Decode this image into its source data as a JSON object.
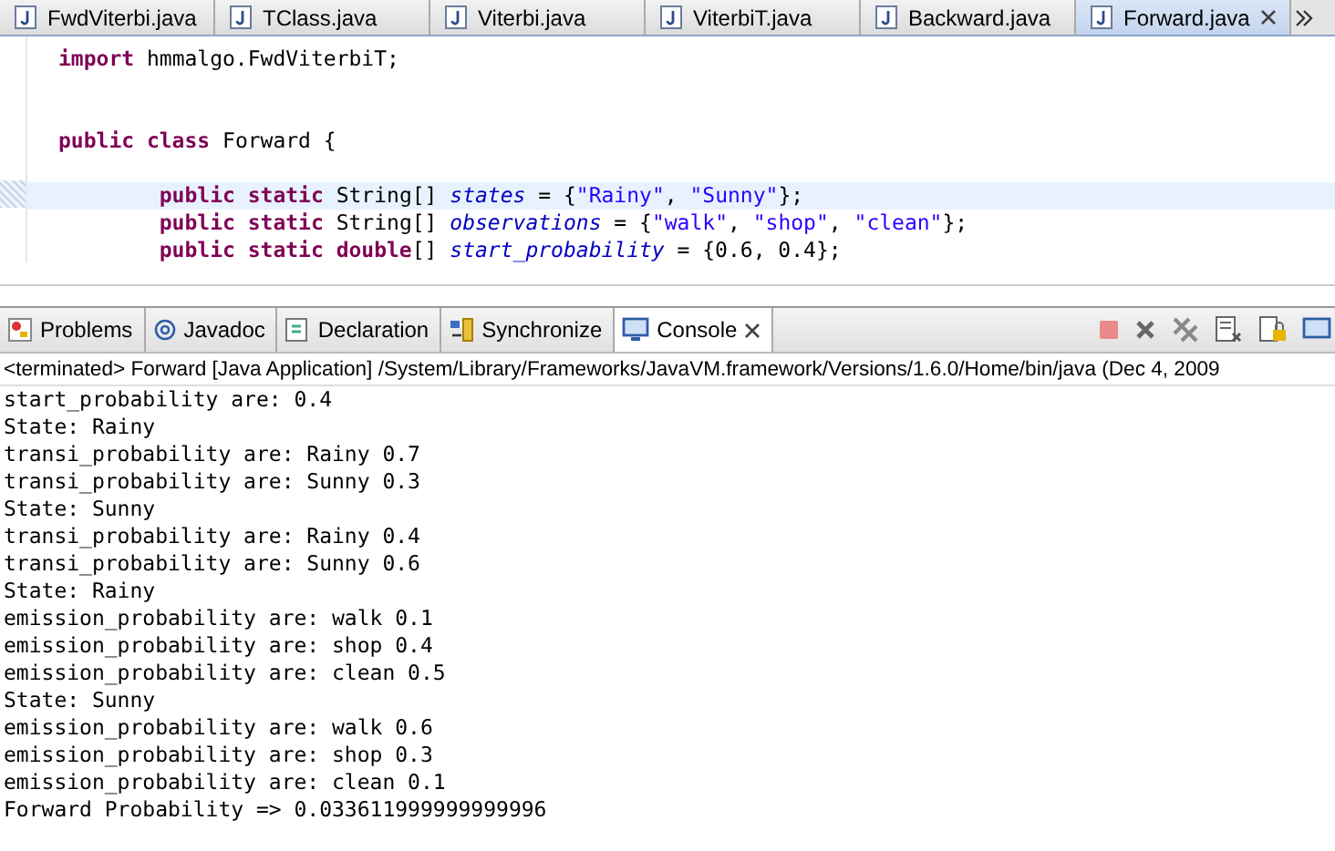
{
  "editor_tabs": [
    {
      "label": "FwdViterbi.java",
      "selected": false
    },
    {
      "label": "TClass.java",
      "selected": false
    },
    {
      "label": "Viterbi.java",
      "selected": false
    },
    {
      "label": "ViterbiT.java",
      "selected": false
    },
    {
      "label": "Backward.java",
      "selected": false
    },
    {
      "label": "Forward.java",
      "selected": true
    }
  ],
  "editor": {
    "lines": [
      {
        "highlighted": false,
        "tokens": [
          {
            "kind": "keyword",
            "text": "import"
          },
          {
            "kind": "plain",
            "text": " hmmalgo.FwdViterbiT;"
          }
        ]
      },
      {
        "highlighted": false
      },
      {
        "highlighted": false
      },
      {
        "highlighted": false,
        "tokens": [
          {
            "kind": "keyword",
            "text": "public class"
          },
          {
            "kind": "plain",
            "text": " Forward {"
          }
        ]
      },
      {
        "highlighted": false
      },
      {
        "highlighted": true,
        "tokens": [
          {
            "kind": "keyword",
            "text": "        public static"
          },
          {
            "kind": "plain",
            "text": " String[] "
          },
          {
            "kind": "field",
            "text": "states"
          },
          {
            "kind": "plain",
            "text": " = {"
          },
          {
            "kind": "string",
            "text": "\"Rainy\""
          },
          {
            "kind": "plain",
            "text": ", "
          },
          {
            "kind": "string",
            "text": "\"Sunny\""
          },
          {
            "kind": "plain",
            "text": "};"
          }
        ]
      },
      {
        "highlighted": false,
        "tokens": [
          {
            "kind": "keyword",
            "text": "        public static"
          },
          {
            "kind": "plain",
            "text": " String[] "
          },
          {
            "kind": "field",
            "text": "observations"
          },
          {
            "kind": "plain",
            "text": " = {"
          },
          {
            "kind": "string",
            "text": "\"walk\""
          },
          {
            "kind": "plain",
            "text": ", "
          },
          {
            "kind": "string",
            "text": "\"shop\""
          },
          {
            "kind": "plain",
            "text": ", "
          },
          {
            "kind": "string",
            "text": "\"clean\""
          },
          {
            "kind": "plain",
            "text": "};"
          }
        ]
      },
      {
        "highlighted": false,
        "tokens": [
          {
            "kind": "keyword",
            "text": "        public static double"
          },
          {
            "kind": "plain",
            "text": "[] "
          },
          {
            "kind": "field",
            "text": "start_probability"
          },
          {
            "kind": "plain",
            "text": " = {0.6, 0.4};"
          }
        ]
      }
    ]
  },
  "console_tabs": [
    {
      "label": "Problems",
      "selected": false,
      "kind": "problems"
    },
    {
      "label": "Javadoc",
      "selected": false,
      "kind": "javadoc"
    },
    {
      "label": "Declaration",
      "selected": false,
      "kind": "declaration"
    },
    {
      "label": "Synchronize",
      "selected": false,
      "kind": "synchronize"
    },
    {
      "label": "Console",
      "selected": true,
      "kind": "console"
    }
  ],
  "console": {
    "header": "<terminated> Forward [Java Application] /System/Library/Frameworks/JavaVM.framework/Versions/1.6.0/Home/bin/java (Dec 4, 2009",
    "lines": [
      "start_probability are: 0.4",
      "State: Rainy",
      "transi_probability are: Rainy 0.7",
      "transi_probability are: Sunny 0.3",
      "State: Sunny",
      "transi_probability are: Rainy 0.4",
      "transi_probability are: Sunny 0.6",
      "State: Rainy",
      "emission_probability are: walk 0.1",
      "emission_probability are: shop 0.4",
      "emission_probability are: clean 0.5",
      "State: Sunny",
      "emission_probability are: walk 0.6",
      "emission_probability are: shop 0.3",
      "emission_probability are: clean 0.1",
      "Forward Probability => 0.033611999999999996"
    ]
  }
}
